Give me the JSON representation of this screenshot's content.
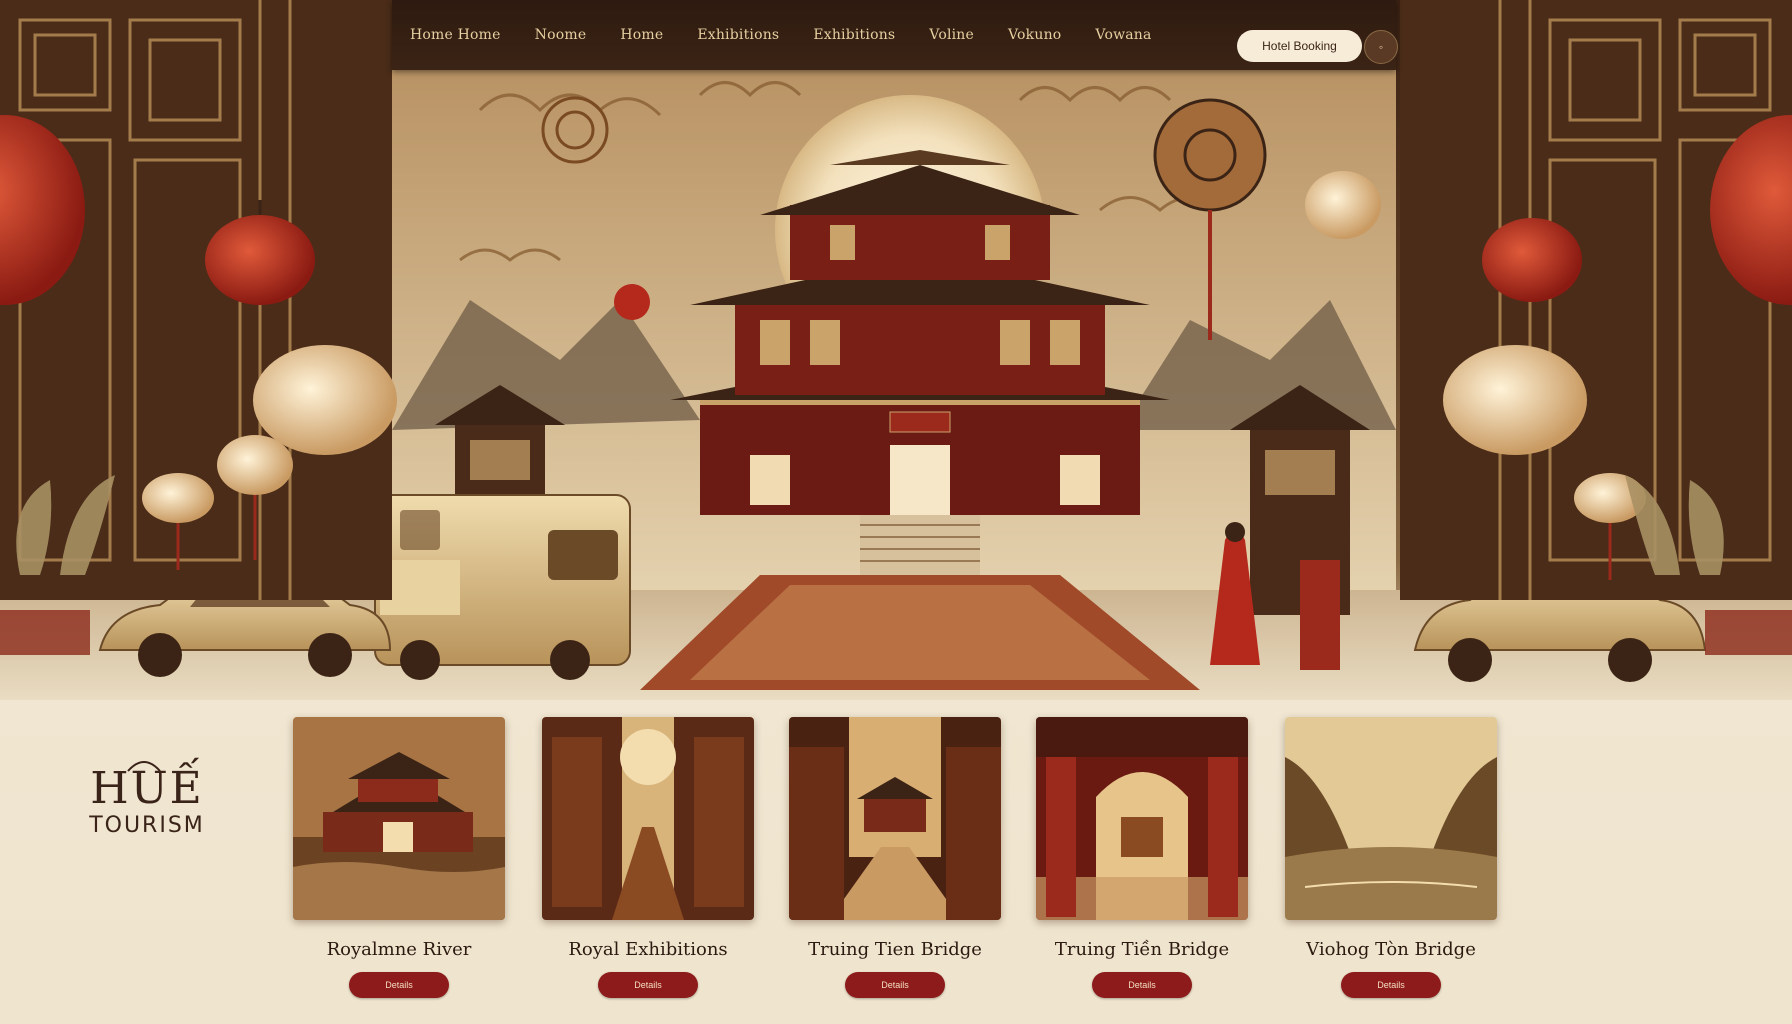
{
  "nav": {
    "links": [
      "Home Home",
      "Noome",
      "Home",
      "Exhibitions",
      "Exhibitions",
      "Voline",
      "Vokuno",
      "Vowana"
    ],
    "cta_label": "Hotel Booking",
    "user_icon": "user-icon"
  },
  "brand": {
    "name": "HUẾ",
    "subtitle": "TOURISM"
  },
  "cards": [
    {
      "title": "Royalmne River",
      "button": "Details"
    },
    {
      "title": "Royal Exhibitions",
      "button": "Details"
    },
    {
      "title": "Truing Tien Bridge",
      "button": "Details"
    },
    {
      "title": "Truing Tiền Bridge",
      "button": "Details"
    },
    {
      "title": "Viohog Tòn Bridge",
      "button": "Details"
    }
  ],
  "colors": {
    "accent_red": "#8e1b1b",
    "gold": "#c9a36a",
    "dark_brown": "#3b2415",
    "cream": "#efe6d3"
  }
}
